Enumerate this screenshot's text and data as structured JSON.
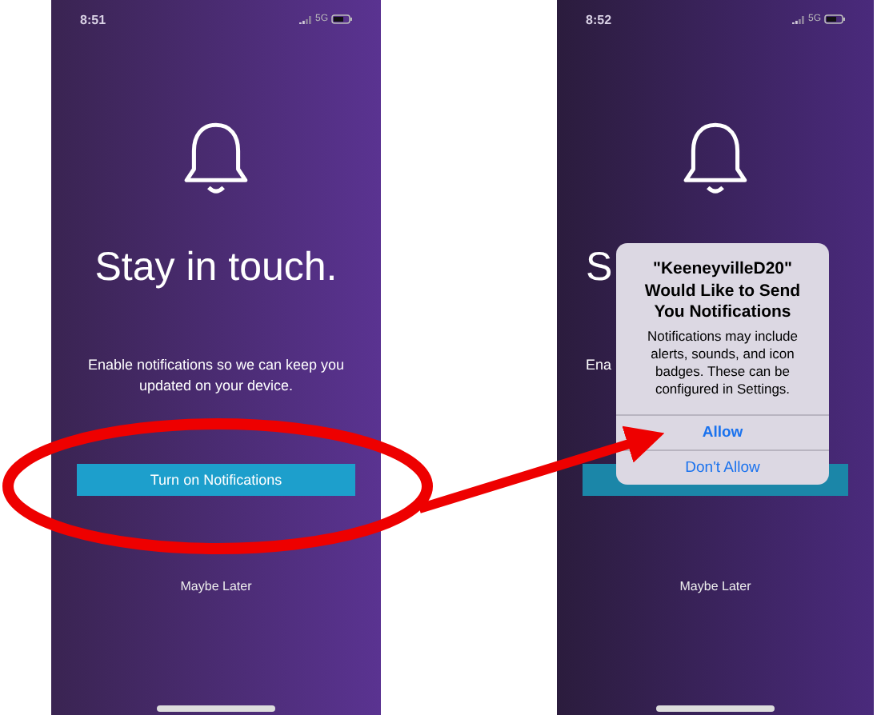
{
  "panels": [
    {
      "status_bar": {
        "time": "8:51",
        "network": "5G"
      },
      "title": "Stay in touch.",
      "message": "Enable notifications so we can keep you updated on your device.",
      "primary_button": "Turn on Notifications",
      "secondary_button": "Maybe Later"
    },
    {
      "status_bar": {
        "time": "8:52",
        "network": "5G"
      },
      "title": "S",
      "message": "Ena",
      "secondary_button": "Maybe Later",
      "alert": {
        "title": "\"KeeneyvilleD20\" Would Like to Send You Notifications",
        "message": "Notifications may include alerts, sounds, and icon badges. These can be configured in Settings.",
        "buttons": [
          "Allow",
          "Don't Allow"
        ]
      }
    }
  ],
  "annotations": {
    "circle_around_button": true,
    "arrow_to_dialog": true
  }
}
